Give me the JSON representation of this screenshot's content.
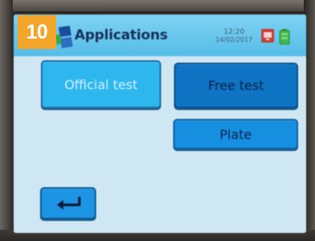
{
  "step_badge": "10",
  "header": {
    "title": "Applications",
    "time": "12:20",
    "date": "14/02/2017",
    "status_icon": "pc-connection-icon",
    "battery_icon": "battery-icon"
  },
  "menu": {
    "official_test": "Official test",
    "free_test": "Free test",
    "plate": "Plate"
  },
  "footer": {
    "back_icon": "return-arrow-icon"
  },
  "colors": {
    "screen_bg": "#cfe7f3",
    "header_bg": "#55bde8",
    "button_light": "#2db7ee",
    "button_dark": "#0f74c4",
    "badge": "#f2a52b"
  }
}
